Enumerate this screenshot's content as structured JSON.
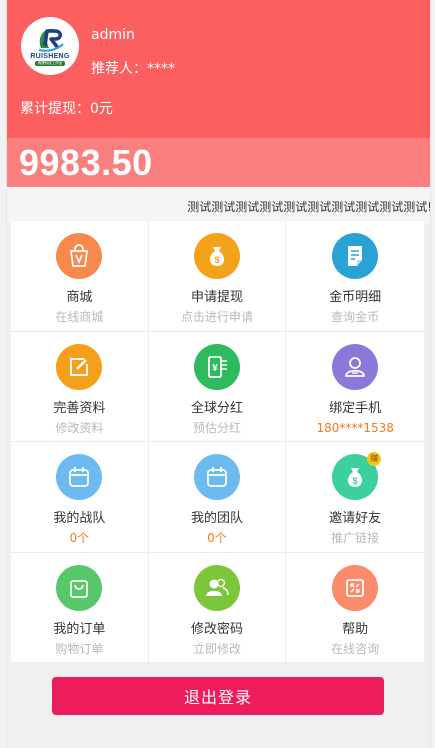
{
  "user": {
    "name": "admin",
    "referrer": "推荐人：****",
    "withdrawn": "累计提现：0元",
    "logo_text": "RUISHENG",
    "logo_sub": "睿晟科技工作室"
  },
  "balance": "9983.50",
  "marquee": "测试测试测试测试测试测试测试测试测试测试!",
  "menu": [
    {
      "label": "商城",
      "sub": "在线商城",
      "icon": "shopping-bag-icon",
      "color": "#f58a4c"
    },
    {
      "label": "申请提现",
      "sub": "点击进行申请",
      "icon": "money-bag-icon",
      "color": "#f5a21a"
    },
    {
      "label": "金币明细",
      "sub": "查询金币",
      "icon": "document-icon",
      "color": "#2aa2d6"
    },
    {
      "label": "完善资料",
      "sub": "修改资料",
      "icon": "edit-icon",
      "color": "#f5a01d"
    },
    {
      "label": "全球分红",
      "sub": "预估分红",
      "icon": "phone-money-icon",
      "color": "#2dbb5e"
    },
    {
      "label": "绑定手机",
      "sub": "180****1538",
      "icon": "user-icon",
      "color": "#8c78d8"
    },
    {
      "label": "我的战队",
      "sub": "0个",
      "icon": "calendar-icon",
      "color": "#6dbaf0"
    },
    {
      "label": "我的团队",
      "sub": "0个",
      "icon": "calendar-icon",
      "color": "#6dbaf0"
    },
    {
      "label": "邀请好友",
      "sub": "推广链接",
      "icon": "invite-money-icon",
      "color": "#3ecf9e",
      "badge": "赚"
    },
    {
      "label": "我的订单",
      "sub": "购物订单",
      "icon": "bag-icon",
      "color": "#56c86a"
    },
    {
      "label": "修改密码",
      "sub": "立即修改",
      "icon": "users-icon",
      "color": "#7cc63a"
    },
    {
      "label": "帮助",
      "sub": "在线咨询",
      "icon": "expand-icon",
      "color": "#fb8b6a"
    }
  ],
  "logout_label": "退出登录"
}
